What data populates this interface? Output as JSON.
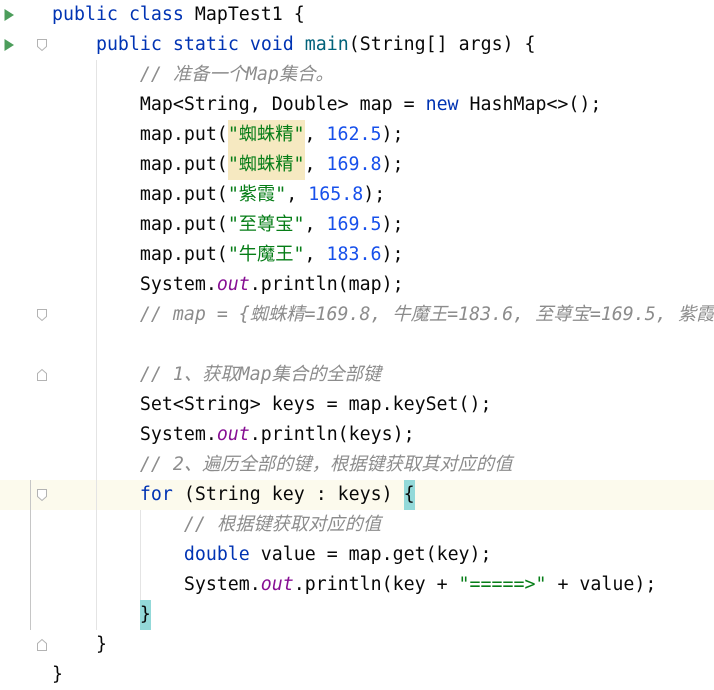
{
  "editor": {
    "colors": {
      "background": "#ffffff",
      "text": "#080808",
      "keyword": "#0033b3",
      "string": "#067d17",
      "number": "#1750eb",
      "comment": "#8c8c8c",
      "static_field": "#871094",
      "method_name": "#00627a",
      "duplicate_key_warning": "#f6e9c1",
      "matched_brace": "#93d9d9",
      "caret_row": "#fcfaed",
      "indent_guide": "#e4e4e4",
      "scope_line": "#c6c6c6",
      "run_icon": "#4c9d5b",
      "fold_marker": "#b3b3b3"
    },
    "lines": [
      {
        "gutter": [
          "run-icon"
        ],
        "tokens": [
          {
            "text": "public",
            "color": "#0033b3"
          },
          {
            "text": " "
          },
          {
            "text": "class",
            "color": "#0033b3"
          },
          {
            "text": " MapTest1 {"
          }
        ]
      },
      {
        "gutter": [
          "run-icon",
          "fold-start-icon"
        ],
        "tokens": [
          {
            "text": "    "
          },
          {
            "text": "public",
            "color": "#0033b3"
          },
          {
            "text": " "
          },
          {
            "text": "static",
            "color": "#0033b3"
          },
          {
            "text": " "
          },
          {
            "text": "void",
            "color": "#0033b3"
          },
          {
            "text": " "
          },
          {
            "text": "main",
            "color": "#00627a"
          },
          {
            "text": "(String[] args) {"
          }
        ]
      },
      {
        "tokens": [
          {
            "text": "        "
          },
          {
            "text": "// 准备一个Map集合。",
            "color": "#8c8c8c",
            "italic": true
          }
        ]
      },
      {
        "tokens": [
          {
            "text": "        Map<String, Double> map = "
          },
          {
            "text": "new",
            "color": "#0033b3"
          },
          {
            "text": " HashMap<>();"
          }
        ]
      },
      {
        "tokens": [
          {
            "text": "        map.put("
          },
          {
            "text": "\"蜘蛛精\"",
            "color": "#067d17",
            "highlight": "#f6e9c1"
          },
          {
            "text": ", "
          },
          {
            "text": "162.5",
            "color": "#1750eb"
          },
          {
            "text": ");"
          }
        ]
      },
      {
        "tokens": [
          {
            "text": "        map.put("
          },
          {
            "text": "\"蜘蛛精\"",
            "color": "#067d17",
            "highlight": "#f6e9c1"
          },
          {
            "text": ", "
          },
          {
            "text": "169.8",
            "color": "#1750eb"
          },
          {
            "text": ");"
          }
        ]
      },
      {
        "tokens": [
          {
            "text": "        map.put("
          },
          {
            "text": "\"紫霞\"",
            "color": "#067d17"
          },
          {
            "text": ", "
          },
          {
            "text": "165.8",
            "color": "#1750eb"
          },
          {
            "text": ");"
          }
        ]
      },
      {
        "tokens": [
          {
            "text": "        map.put("
          },
          {
            "text": "\"至尊宝\"",
            "color": "#067d17"
          },
          {
            "text": ", "
          },
          {
            "text": "169.5",
            "color": "#1750eb"
          },
          {
            "text": ");"
          }
        ]
      },
      {
        "tokens": [
          {
            "text": "        map.put("
          },
          {
            "text": "\"牛魔王\"",
            "color": "#067d17"
          },
          {
            "text": ", "
          },
          {
            "text": "183.6",
            "color": "#1750eb"
          },
          {
            "text": ");"
          }
        ]
      },
      {
        "tokens": [
          {
            "text": "        System."
          },
          {
            "text": "out",
            "color": "#871094",
            "italic": true
          },
          {
            "text": ".println(map);"
          }
        ]
      },
      {
        "gutter": [
          "fold-start-icon"
        ],
        "tokens": [
          {
            "text": "        "
          },
          {
            "text": "// map = {蜘蛛精=169.8, 牛魔王=183.6, 至尊宝=169.5, 紫霞",
            "color": "#8c8c8c",
            "italic": true
          }
        ]
      },
      {
        "tokens": []
      },
      {
        "gutter": [
          "fold-end-icon"
        ],
        "tokens": [
          {
            "text": "        "
          },
          {
            "text": "// 1、获取Map集合的全部键",
            "color": "#8c8c8c",
            "italic": true
          }
        ]
      },
      {
        "tokens": [
          {
            "text": "        Set<String> keys = map.keySet();"
          }
        ]
      },
      {
        "tokens": [
          {
            "text": "        System."
          },
          {
            "text": "out",
            "color": "#871094",
            "italic": true
          },
          {
            "text": ".println(keys);"
          }
        ]
      },
      {
        "tokens": [
          {
            "text": "        "
          },
          {
            "text": "// 2、遍历全部的键，根据键获取其对应的值",
            "color": "#8c8c8c",
            "italic": true
          }
        ]
      },
      {
        "current": true,
        "gutter": [
          "fold-start-icon"
        ],
        "tokens": [
          {
            "text": "        "
          },
          {
            "text": "for",
            "color": "#0033b3"
          },
          {
            "text": " (String key : keys) "
          },
          {
            "text": "{",
            "highlight": "#93d9d9"
          }
        ]
      },
      {
        "tokens": [
          {
            "text": "            "
          },
          {
            "text": "// 根据键获取对应的值",
            "color": "#8c8c8c",
            "italic": true
          }
        ]
      },
      {
        "tokens": [
          {
            "text": "            "
          },
          {
            "text": "double",
            "color": "#0033b3"
          },
          {
            "text": " value = map.get(key);"
          }
        ]
      },
      {
        "tokens": [
          {
            "text": "            System."
          },
          {
            "text": "out",
            "color": "#871094",
            "italic": true
          },
          {
            "text": ".println(key + "
          },
          {
            "text": "\"=====>\"",
            "color": "#067d17"
          },
          {
            "text": " + value);"
          }
        ]
      },
      {
        "tokens": [
          {
            "text": "        "
          },
          {
            "text": "}",
            "highlight": "#93d9d9"
          }
        ]
      },
      {
        "gutter": [
          "fold-end-icon"
        ],
        "tokens": [
          {
            "text": "    }"
          }
        ]
      },
      {
        "tokens": [
          {
            "text": "}"
          }
        ]
      }
    ]
  }
}
